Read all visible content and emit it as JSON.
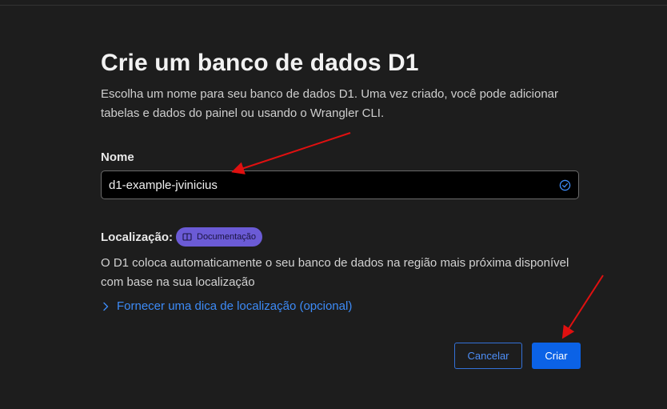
{
  "dialog": {
    "title": "Crie um banco de dados D1",
    "description": "Escolha um nome para seu banco de dados D1. Uma vez criado, você pode adicionar tabelas e dados do painel ou usando o Wrangler CLI."
  },
  "name_field": {
    "label": "Nome",
    "value": "d1-example-jvinicius",
    "status_icon": "check-circle-icon"
  },
  "location": {
    "label": "Localização:",
    "doc_badge": "Documentação",
    "description": "O D1 coloca automaticamente o seu banco de dados na região mais próxima disponível com base na sua localização",
    "hint_link": "Fornecer uma dica de localização (opcional)"
  },
  "buttons": {
    "cancel": "Cancelar",
    "create": "Criar"
  },
  "colors": {
    "background": "#1d1d1d",
    "accent_blue": "#0b62e6",
    "badge_purple": "#6b5bd6",
    "annotation_red": "#e01010"
  }
}
